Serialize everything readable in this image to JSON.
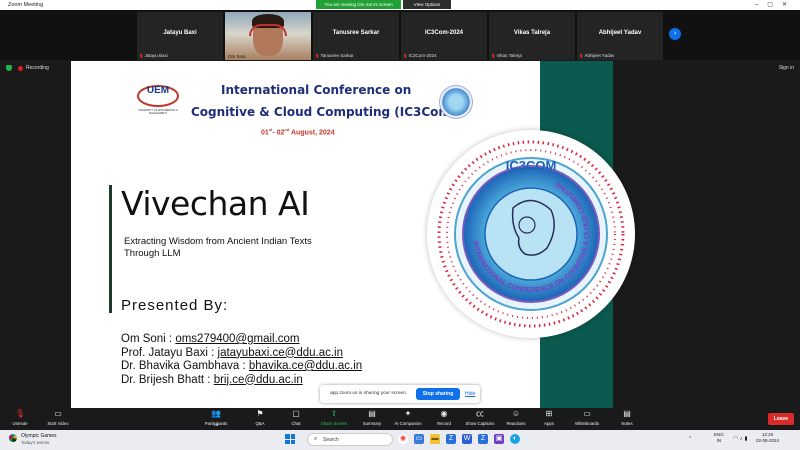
{
  "window": {
    "title": "Zoom Meeting",
    "viewing_banner": "You are viewing Om Soni's screen",
    "view_options": "View Options"
  },
  "participants": [
    {
      "name": "Jatayu Baxi",
      "label": "Jatayu Baxi"
    },
    {
      "name": "Om Soni",
      "label": "Om Soni"
    },
    {
      "name": "Tanusree Sarkar",
      "label": "Tanusree Sarkar"
    },
    {
      "name": "IC3Com-2024",
      "label": "IC3Com-2024"
    },
    {
      "name": "Vikas Talreja",
      "label": "Vikas Talreja"
    },
    {
      "name": "Abhijeet Yadav",
      "label": "Abhijeet Yadav"
    }
  ],
  "status": {
    "recording": "Recording",
    "sign_in": "Sign in"
  },
  "slide": {
    "org_logo": "UEM",
    "org_subtitle": "UNIVERSITY OF ENGINEERING & MANAGEMENT",
    "conference_line1": "International Conference on",
    "conference_line2": "Cognitive & Cloud Computing (IC3Com)",
    "date_day1": "01",
    "date_sup1": "st",
    "date_day2": "- 02",
    "date_sup2": "nd",
    "date_rest": " August, 2024",
    "title": "Vivechan AI",
    "subtitle_l1": "Extracting Wisdom from Ancient Indian Texts",
    "subtitle_l2": "Through LLM",
    "presented_by": "Presented By:",
    "authors": [
      {
        "name": "Om Soni : ",
        "email": "oms279400@gmail.com"
      },
      {
        "name": "Prof. Jatayu Baxi : ",
        "email": "jatayubaxi.ce@ddu.ac.in"
      },
      {
        "name": "Dr. Bhavika Gambhava : ",
        "email": "bhavika.ce@ddu.ac.in"
      },
      {
        "name": "Dr. Brijesh Bhatt : ",
        "email": "brij.ce@ddu.ac.in"
      }
    ],
    "seal_top": "IC3COM",
    "seal_ring": "INTERNATIONAL CONFERENCE ON COGNITIVE & CLOUD COMPUTING"
  },
  "share_notice": {
    "message": "app.zoom.us is sharing your screen.",
    "stop": "Stop sharing",
    "hide": "Hide"
  },
  "toolbar": {
    "unmute": "Unmute",
    "start_video": "Start Video",
    "participants": "Participants",
    "participants_count": "16",
    "qa": "Q&A",
    "chat": "Chat",
    "share_screen": "Share Screen",
    "summary": "Summary",
    "ai_companion": "AI Companion",
    "record": "Record",
    "show_captions": "Show Captions",
    "reactions": "Reactions",
    "apps": "Apps",
    "whiteboards": "Whiteboards",
    "notes": "Notes",
    "leave": "Leave"
  },
  "taskbar": {
    "weather_title": "Olympic Games",
    "weather_sub": "Today's events",
    "search_placeholder": "Search",
    "lang_1": "ENG",
    "lang_2": "IN",
    "time": "12:26",
    "date": "02-08-2024"
  },
  "colors": {
    "zoom_blue": "#0e71eb",
    "share_green": "#22c55e",
    "leave_red": "#d92b2b",
    "slide_teal": "#0b5a4f",
    "conference_navy": "#1f2e7a"
  }
}
